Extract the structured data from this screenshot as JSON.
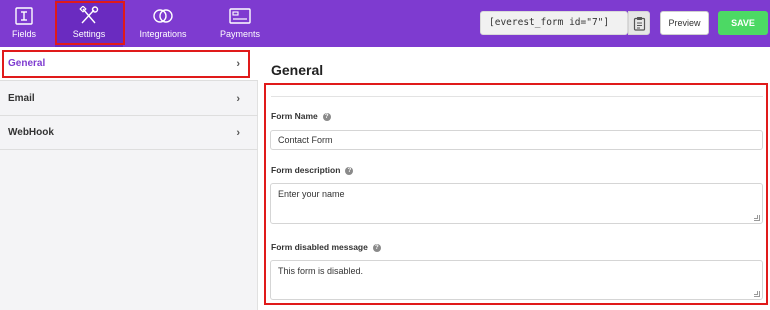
{
  "tabs": [
    {
      "label": "Fields",
      "icon": "fields-icon"
    },
    {
      "label": "Settings",
      "icon": "wrench-screwdriver-icon"
    },
    {
      "label": "Integrations",
      "icon": "integrations-icon"
    },
    {
      "label": "Payments",
      "icon": "payments-icon"
    }
  ],
  "header": {
    "shortcode": "[everest_form id=\"7\"]",
    "preview_label": "Preview",
    "save_label": "SAVE"
  },
  "sidebar": {
    "items": [
      {
        "label": "General",
        "active": true
      },
      {
        "label": "Email",
        "active": false
      },
      {
        "label": "WebHook",
        "active": false
      }
    ]
  },
  "main": {
    "title": "General",
    "form_name_label": "Form Name",
    "form_name_value": "Contact Form",
    "form_description_label": "Form description",
    "form_description_value": "Enter your name",
    "form_disabled_label": "Form disabled message",
    "form_disabled_value": "This form is disabled."
  },
  "colors": {
    "brand": "#7e3bd0",
    "save": "#4cd964",
    "highlight": "#e01a1a"
  }
}
